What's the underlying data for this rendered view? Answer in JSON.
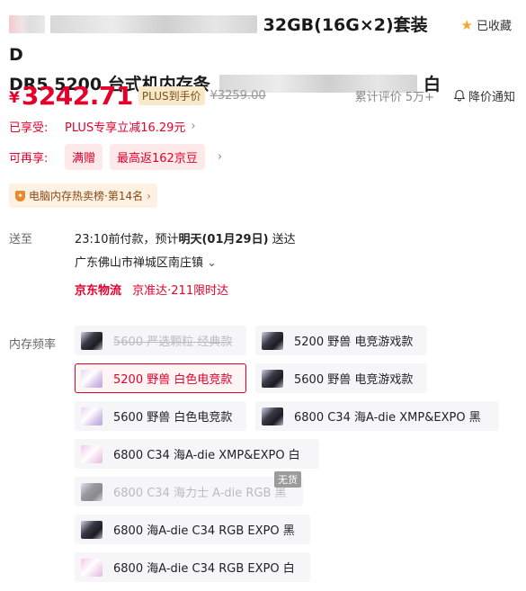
{
  "product": {
    "title_visible_1": "32GB(16G×2)套装 D",
    "title_visible_2": "DR5 5200 台式机内存条",
    "title_visible_3": "白",
    "favorite_label": "已收藏"
  },
  "pricing": {
    "currency": "¥",
    "price": "3242.71",
    "plus_tag": "PLUS到手价",
    "original_price": "¥3259.00",
    "reviews": "累计评价 5万+",
    "notify": "降价通知"
  },
  "promo": {
    "enjoyed_label": "已享受:",
    "enjoyed_text": "PLUS专享立减16.29元",
    "more_label": "可再享:",
    "pills": [
      "满赠",
      "最高返162京豆"
    ],
    "rank": "电脑内存热卖榜·第14名"
  },
  "delivery": {
    "label": "送至",
    "line1_prefix": "23:10前付款，预计",
    "line1_bold": "明天(01月29日)",
    "line1_suffix": " 送达",
    "address": "广东佛山市禅城区南庄镇",
    "logistics": "京东物流",
    "logistics_note": "京准达·211限时达"
  },
  "options": {
    "label": "内存频率",
    "items": [
      {
        "label": "5600 严选颗粒 经典款",
        "thumb": "dark",
        "state": "unavailable"
      },
      {
        "label": "5200 野兽 电竞游戏款",
        "thumb": "dark",
        "state": "normal"
      },
      {
        "label": "5200 野兽 白色电竞款",
        "thumb": "white",
        "state": "selected"
      },
      {
        "label": "5600 野兽 电竞游戏款",
        "thumb": "dark",
        "state": "normal"
      },
      {
        "label": "5600 野兽 白色电竞款",
        "thumb": "white",
        "state": "normal"
      },
      {
        "label": "6800 C34 海A-die XMP&EXPO 黑",
        "thumb": "dark",
        "state": "normal"
      },
      {
        "label": "6800 C34 海A-die XMP&EXPO 白",
        "thumb": "pinkish",
        "state": "normal"
      },
      {
        "label": "6800 C34 海力士 A-die RGB 黑",
        "thumb": "dark",
        "state": "out-of-stock"
      },
      {
        "label": "6800 海A-die C34 RGB EXPO 黑",
        "thumb": "dark",
        "state": "normal"
      },
      {
        "label": "6800 海A-die C34 RGB EXPO 白",
        "thumb": "pinkish",
        "state": "normal"
      }
    ],
    "out_of_stock_badge": "无货"
  },
  "icons": [
    "star-icon",
    "bell-icon",
    "chevron-right-icon",
    "chevron-down-icon",
    "shield-icon"
  ],
  "colors": {
    "accent": "#e4002b",
    "plus": "#f7e9c9",
    "star": "#f5a623"
  }
}
